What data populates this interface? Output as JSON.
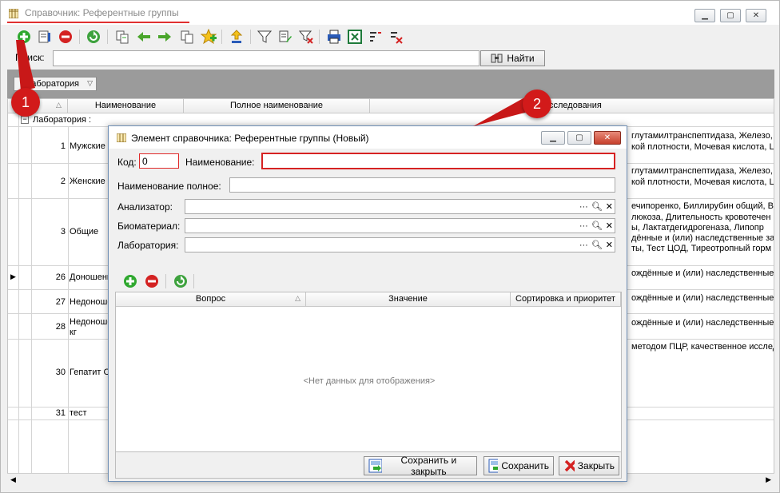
{
  "window": {
    "title": "Справочник: Референтные группы",
    "controls": [
      "minimize",
      "restore",
      "close"
    ]
  },
  "toolbar": {
    "icons": [
      "add-icon",
      "edit-icon",
      "delete-icon",
      "refresh-icon",
      "copy-icon",
      "arrow-left-icon",
      "arrow-right-icon",
      "copy2-icon",
      "add-star-icon",
      "import-icon",
      "filter-icon",
      "filter-edit-icon",
      "filter-clear-icon",
      "print-icon",
      "excel-icon",
      "sort-icon",
      "clear-sort-icon"
    ],
    "colors": {
      "add": "#2fa82f",
      "delete": "#d42222",
      "refresh": "#3ea23e",
      "arrow": "#4aa52c"
    }
  },
  "search": {
    "label": "Поиск:",
    "value": "",
    "find_button": "Найти"
  },
  "group_panel": {
    "chip": "Лаборатория"
  },
  "grid": {
    "columns": [
      "Наименование",
      "Полное наименование",
      "Исследования"
    ],
    "group_row": "Лаборатория :",
    "rows": [
      {
        "num": "1",
        "name": "Мужские",
        "tests": [
          "глутамилтранспептидаза, Железо,",
          "кой плотности, Мочевая кислота, Ц"
        ]
      },
      {
        "num": "2",
        "name": "Женские",
        "tests": [
          "глутамилтранспептидаза, Железо,",
          "кой плотности, Мочевая кислота, Ц"
        ]
      },
      {
        "num": "3",
        "name": "Общие",
        "tests": [
          "ечипоренко, Биллирубин общий, Вр",
          "люкоза, Длительность кровотечен",
          "ы, Лактатдегидрогеназа, Липопр",
          "дённые и (или) наследственные за",
          "ты, Тест ЦОД, Тиреотропный горм"
        ]
      },
      {
        "num": "26",
        "name": "Доношенн",
        "tests": [
          "ождённые и (или) наследственные"
        ]
      },
      {
        "num": "27",
        "name": "Недоноше",
        "tests": [
          "ождённые и (или) наследственные"
        ]
      },
      {
        "num": "28",
        "name": "Недоноше",
        "name2": "кг",
        "tests": [
          "ождённые и (или) наследственные"
        ]
      },
      {
        "num": "30",
        "name": "Гепатит С",
        "tests": [
          "методом ПЦР, качественное исслед"
        ]
      },
      {
        "num": "31",
        "name": "тест",
        "tests": []
      }
    ]
  },
  "dialog": {
    "title": "Элемент справочника: Референтные группы (Новый)",
    "code_label": "Код:",
    "code_value": "0",
    "name_label": "Наименование:",
    "name_value": "",
    "fullname_label": "Наименование полное:",
    "analyzer_label": "Анализатор:",
    "biomaterial_label": "Биоматериал:",
    "laboratory_label": "Лаборатория:",
    "lookup_dots": "···",
    "grid_columns": [
      "Вопрос",
      "Значение",
      "Сортировка и приоритет"
    ],
    "no_data": "<Нет данных для отображения>",
    "save_close_button": "Сохранить и закрыть",
    "save_button": "Сохранить",
    "close_button": "Закрыть"
  },
  "annotations": [
    "1",
    "2"
  ]
}
